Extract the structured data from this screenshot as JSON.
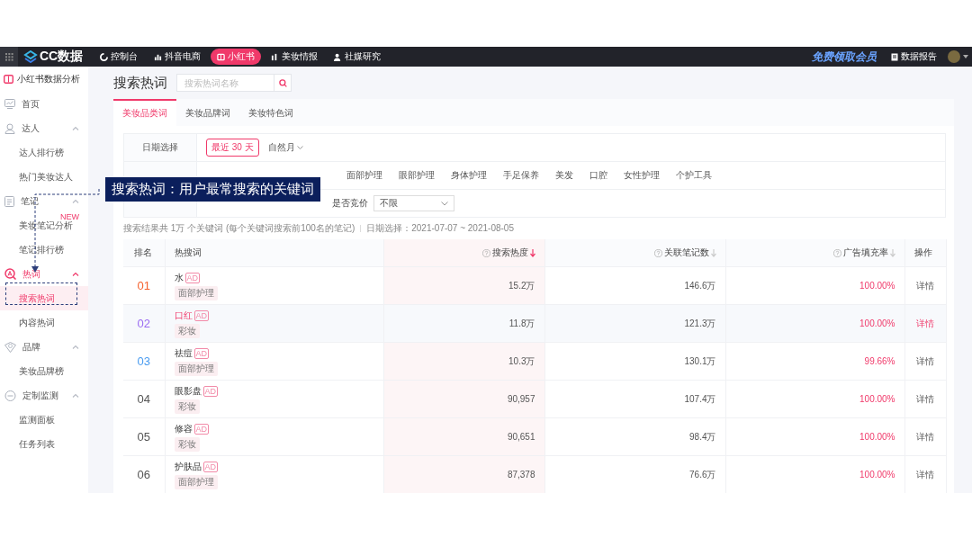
{
  "nav": {
    "logo": "CC数据",
    "items": [
      {
        "label": "控制台",
        "selected": false
      },
      {
        "label": "抖音电商",
        "selected": false
      },
      {
        "label": "小红书",
        "selected": true
      },
      {
        "label": "美妆情报",
        "selected": false
      },
      {
        "label": "社媒研究",
        "selected": false
      }
    ],
    "promo": "免费领取会员",
    "report": "数据报告"
  },
  "sidebar": {
    "title": "小红书数据分析",
    "items": [
      {
        "label": "首页",
        "active": false
      },
      {
        "label": "达人",
        "active": false,
        "expanded": true,
        "children": [
          {
            "label": "达人排行榜",
            "selected": false
          },
          {
            "label": "热门美妆达人",
            "selected": false
          }
        ]
      },
      {
        "label": "笔记",
        "active": false,
        "expanded": true,
        "children": [
          {
            "label": "美妆笔记分析",
            "selected": false,
            "badge": "NEW"
          },
          {
            "label": "笔记排行榜",
            "selected": false
          }
        ]
      },
      {
        "label": "热词",
        "active": true,
        "expanded": true,
        "children": [
          {
            "label": "搜索热词",
            "selected": true
          },
          {
            "label": "内容热词",
            "selected": false
          }
        ]
      },
      {
        "label": "品牌",
        "active": false,
        "expanded": true,
        "children": [
          {
            "label": "美妆品牌榜",
            "selected": false
          }
        ]
      },
      {
        "label": "定制监测",
        "active": false,
        "expanded": true,
        "children": [
          {
            "label": "监测面板",
            "selected": false
          },
          {
            "label": "任务列表",
            "selected": false
          }
        ]
      }
    ]
  },
  "page": {
    "title": "搜索热词",
    "search": {
      "placeholder": "搜索热词名称"
    }
  },
  "tabs": [
    {
      "label": "美妆品类词",
      "selected": true
    },
    {
      "label": "美妆品牌词",
      "selected": false
    },
    {
      "label": "美妆特色词",
      "selected": false
    }
  ],
  "filters": {
    "date": {
      "label": "日期选择",
      "options": [
        {
          "label": "最近 30 天",
          "selected": true,
          "kind": "chip"
        },
        {
          "label": "自然月",
          "selected": false,
          "kind": "dropdown"
        }
      ]
    },
    "category": {
      "options": [
        {
          "label": "面部护理",
          "selected": false
        },
        {
          "label": "眼部护理",
          "selected": false
        },
        {
          "label": "身体护理",
          "selected": false
        },
        {
          "label": "手足保养",
          "selected": false
        },
        {
          "label": "美发",
          "selected": false
        },
        {
          "label": "口腔",
          "selected": false
        },
        {
          "label": "女性护理",
          "selected": false
        },
        {
          "label": "个护工具",
          "selected": false
        }
      ]
    },
    "general": {
      "selects": [
        {
          "label": "是否竞价",
          "value": "不限"
        }
      ]
    }
  },
  "summary": {
    "count": "搜索结果共 1万 个关键词 (每个关键词搜索前100名的笔记)",
    "dates": "日期选择：2021-07-07 ~ 2021-08-05"
  },
  "table": {
    "columns": [
      {
        "label": "排名",
        "kind": "plain"
      },
      {
        "label": "热搜词",
        "kind": "plain"
      },
      {
        "label": "搜索热度",
        "kind": "sort",
        "sorted": true
      },
      {
        "label": "关联笔记数",
        "kind": "sort",
        "sorted": false
      },
      {
        "label": "广告填充率",
        "kind": "sort",
        "sorted": false
      },
      {
        "label": "操作",
        "kind": "plain"
      }
    ],
    "rows": [
      {
        "rank": "01",
        "color": "#f5622f",
        "keyword": "水",
        "badge": "AD",
        "tag": "面部护理",
        "heat": "15.2万",
        "notes": "146.6万",
        "fill": "100.00%",
        "action": "详情",
        "highlighted": false
      },
      {
        "rank": "02",
        "color": "#9b6cf2",
        "keyword": "口红",
        "badge": "AD",
        "tag": "彩妆",
        "heat": "11.8万",
        "notes": "121.3万",
        "fill": "100.00%",
        "action": "详情",
        "highlighted": true
      },
      {
        "rank": "03",
        "color": "#4a9cf0",
        "keyword": "祛痘",
        "badge": "AD",
        "tag": "面部护理",
        "heat": "10.3万",
        "notes": "130.1万",
        "fill": "99.66%",
        "action": "详情",
        "highlighted": false
      },
      {
        "rank": "04",
        "color": "#555555",
        "keyword": "眼影盘",
        "badge": "AD",
        "tag": "彩妆",
        "heat": "90,957",
        "notes": "107.4万",
        "fill": "100.00%",
        "action": "详情",
        "highlighted": false
      },
      {
        "rank": "05",
        "color": "#555555",
        "keyword": "修容",
        "badge": "AD",
        "tag": "彩妆",
        "heat": "90,651",
        "notes": "98.4万",
        "fill": "100.00%",
        "action": "详情",
        "highlighted": false
      },
      {
        "rank": "06",
        "color": "#555555",
        "keyword": "护肤品",
        "badge": "AD",
        "tag": "面部护理",
        "heat": "87,378",
        "notes": "76.6万",
        "fill": "100.00%",
        "action": "详情",
        "highlighted": false
      }
    ]
  },
  "callout": {
    "text": "搜索热词：用户最常搜索的关键词"
  }
}
